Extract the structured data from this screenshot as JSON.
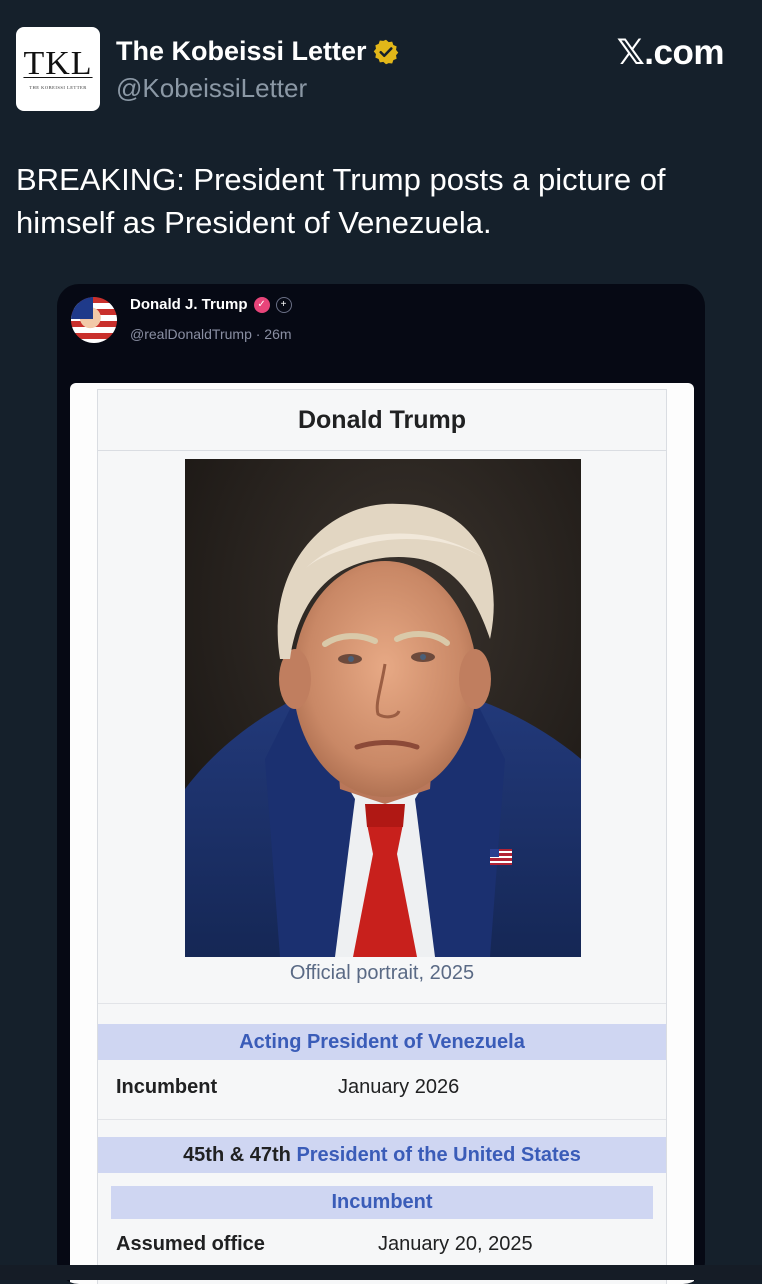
{
  "tweet": {
    "author_name": "The Kobeissi Letter",
    "author_handle": "@KobeissiLetter",
    "avatar_text": "TKL",
    "avatar_subtext": "THE KOBEISSI LETTER",
    "brand": "𝕏.com",
    "text": "BREAKING: President Trump posts a picture of himself as President of Venezuela."
  },
  "embedded_post": {
    "author_name": "Donald J. Trump",
    "meta": "@realDonaldTrump · 26m",
    "infobox": {
      "title": "Donald Trump",
      "caption": "Official portrait, 2025",
      "section1": {
        "heading": "Acting President of Venezuela",
        "label": "Incumbent",
        "value": "January 2026"
      },
      "section2": {
        "heading_prefix": "45th & 47th",
        "heading_link": "President of the United States",
        "subheading": "Incumbent",
        "label": "Assumed office",
        "value": "January 20, 2025"
      }
    }
  },
  "colors": {
    "background": "#15202b",
    "verified_gold": "#e2b719",
    "link_blue": "#3a5cb8",
    "section_bg": "#cfd6f2"
  }
}
